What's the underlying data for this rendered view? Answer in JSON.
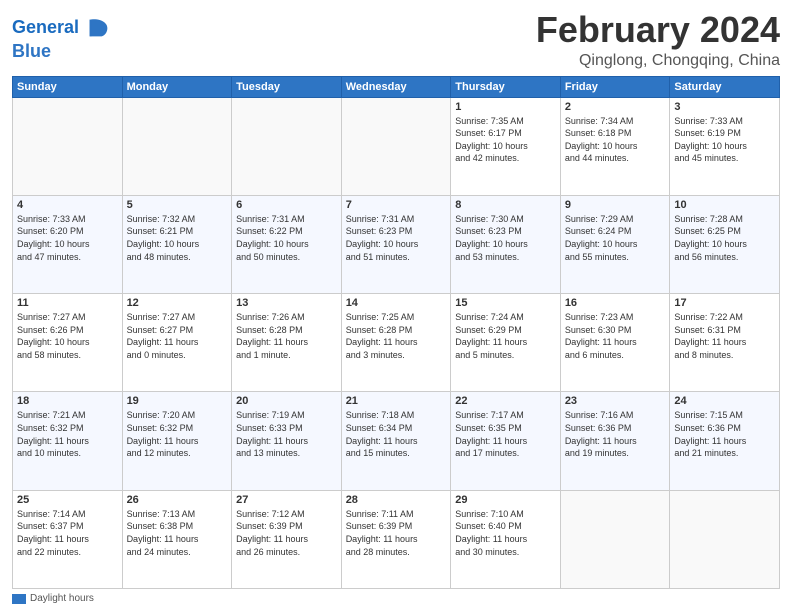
{
  "header": {
    "logo_line1": "General",
    "logo_line2": "Blue",
    "month": "February 2024",
    "location": "Qinglong, Chongqing, China"
  },
  "weekdays": [
    "Sunday",
    "Monday",
    "Tuesday",
    "Wednesday",
    "Thursday",
    "Friday",
    "Saturday"
  ],
  "legend_label": "Daylight hours",
  "weeks": [
    [
      {
        "day": "",
        "info": ""
      },
      {
        "day": "",
        "info": ""
      },
      {
        "day": "",
        "info": ""
      },
      {
        "day": "",
        "info": ""
      },
      {
        "day": "1",
        "info": "Sunrise: 7:35 AM\nSunset: 6:17 PM\nDaylight: 10 hours\nand 42 minutes."
      },
      {
        "day": "2",
        "info": "Sunrise: 7:34 AM\nSunset: 6:18 PM\nDaylight: 10 hours\nand 44 minutes."
      },
      {
        "day": "3",
        "info": "Sunrise: 7:33 AM\nSunset: 6:19 PM\nDaylight: 10 hours\nand 45 minutes."
      }
    ],
    [
      {
        "day": "4",
        "info": "Sunrise: 7:33 AM\nSunset: 6:20 PM\nDaylight: 10 hours\nand 47 minutes."
      },
      {
        "day": "5",
        "info": "Sunrise: 7:32 AM\nSunset: 6:21 PM\nDaylight: 10 hours\nand 48 minutes."
      },
      {
        "day": "6",
        "info": "Sunrise: 7:31 AM\nSunset: 6:22 PM\nDaylight: 10 hours\nand 50 minutes."
      },
      {
        "day": "7",
        "info": "Sunrise: 7:31 AM\nSunset: 6:23 PM\nDaylight: 10 hours\nand 51 minutes."
      },
      {
        "day": "8",
        "info": "Sunrise: 7:30 AM\nSunset: 6:23 PM\nDaylight: 10 hours\nand 53 minutes."
      },
      {
        "day": "9",
        "info": "Sunrise: 7:29 AM\nSunset: 6:24 PM\nDaylight: 10 hours\nand 55 minutes."
      },
      {
        "day": "10",
        "info": "Sunrise: 7:28 AM\nSunset: 6:25 PM\nDaylight: 10 hours\nand 56 minutes."
      }
    ],
    [
      {
        "day": "11",
        "info": "Sunrise: 7:27 AM\nSunset: 6:26 PM\nDaylight: 10 hours\nand 58 minutes."
      },
      {
        "day": "12",
        "info": "Sunrise: 7:27 AM\nSunset: 6:27 PM\nDaylight: 11 hours\nand 0 minutes."
      },
      {
        "day": "13",
        "info": "Sunrise: 7:26 AM\nSunset: 6:28 PM\nDaylight: 11 hours\nand 1 minute."
      },
      {
        "day": "14",
        "info": "Sunrise: 7:25 AM\nSunset: 6:28 PM\nDaylight: 11 hours\nand 3 minutes."
      },
      {
        "day": "15",
        "info": "Sunrise: 7:24 AM\nSunset: 6:29 PM\nDaylight: 11 hours\nand 5 minutes."
      },
      {
        "day": "16",
        "info": "Sunrise: 7:23 AM\nSunset: 6:30 PM\nDaylight: 11 hours\nand 6 minutes."
      },
      {
        "day": "17",
        "info": "Sunrise: 7:22 AM\nSunset: 6:31 PM\nDaylight: 11 hours\nand 8 minutes."
      }
    ],
    [
      {
        "day": "18",
        "info": "Sunrise: 7:21 AM\nSunset: 6:32 PM\nDaylight: 11 hours\nand 10 minutes."
      },
      {
        "day": "19",
        "info": "Sunrise: 7:20 AM\nSunset: 6:32 PM\nDaylight: 11 hours\nand 12 minutes."
      },
      {
        "day": "20",
        "info": "Sunrise: 7:19 AM\nSunset: 6:33 PM\nDaylight: 11 hours\nand 13 minutes."
      },
      {
        "day": "21",
        "info": "Sunrise: 7:18 AM\nSunset: 6:34 PM\nDaylight: 11 hours\nand 15 minutes."
      },
      {
        "day": "22",
        "info": "Sunrise: 7:17 AM\nSunset: 6:35 PM\nDaylight: 11 hours\nand 17 minutes."
      },
      {
        "day": "23",
        "info": "Sunrise: 7:16 AM\nSunset: 6:36 PM\nDaylight: 11 hours\nand 19 minutes."
      },
      {
        "day": "24",
        "info": "Sunrise: 7:15 AM\nSunset: 6:36 PM\nDaylight: 11 hours\nand 21 minutes."
      }
    ],
    [
      {
        "day": "25",
        "info": "Sunrise: 7:14 AM\nSunset: 6:37 PM\nDaylight: 11 hours\nand 22 minutes."
      },
      {
        "day": "26",
        "info": "Sunrise: 7:13 AM\nSunset: 6:38 PM\nDaylight: 11 hours\nand 24 minutes."
      },
      {
        "day": "27",
        "info": "Sunrise: 7:12 AM\nSunset: 6:39 PM\nDaylight: 11 hours\nand 26 minutes."
      },
      {
        "day": "28",
        "info": "Sunrise: 7:11 AM\nSunset: 6:39 PM\nDaylight: 11 hours\nand 28 minutes."
      },
      {
        "day": "29",
        "info": "Sunrise: 7:10 AM\nSunset: 6:40 PM\nDaylight: 11 hours\nand 30 minutes."
      },
      {
        "day": "",
        "info": ""
      },
      {
        "day": "",
        "info": ""
      }
    ]
  ]
}
